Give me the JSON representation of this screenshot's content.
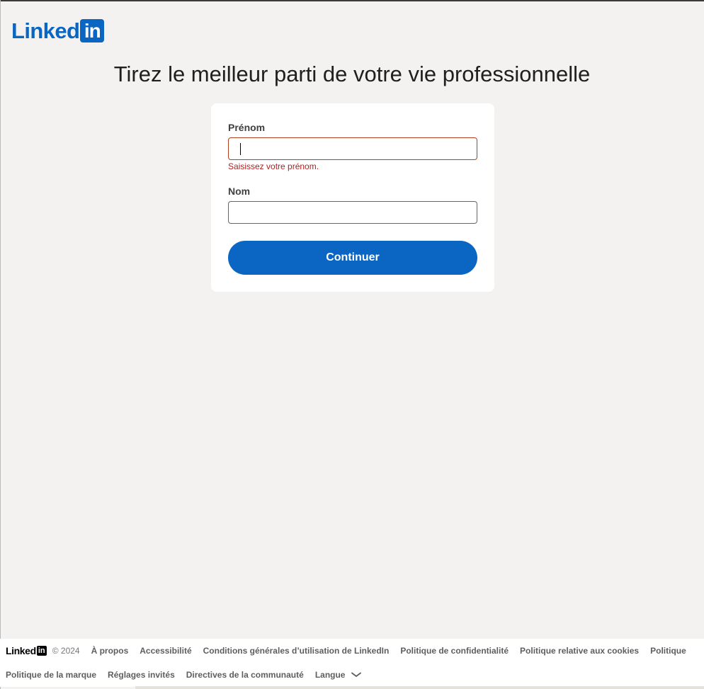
{
  "logo": {
    "text": "Linked",
    "box": "in"
  },
  "headline": "Tirez le meilleur parti de votre vie professionnelle",
  "form": {
    "first_name_label": "Prénom",
    "first_name_value": "",
    "first_name_error": "Saisissez votre prénom.",
    "last_name_label": "Nom",
    "last_name_value": "",
    "submit_label": "Continuer"
  },
  "footer": {
    "logo_text": "Linked",
    "logo_box": "in",
    "copyright": "© 2024",
    "row1": [
      "À propos",
      "Accessibilité",
      "Conditions générales d’utilisation de LinkedIn",
      "Politique de confidentialité",
      "Politique relative aux cookies",
      "Politique"
    ],
    "row2": [
      "Politique de la marque",
      "Réglages invités",
      "Directives de la communauté"
    ],
    "language_label": "Langue"
  },
  "colors": {
    "brand": "#0a66c2",
    "error": "#b21e1e",
    "background": "#f3f2f0"
  }
}
